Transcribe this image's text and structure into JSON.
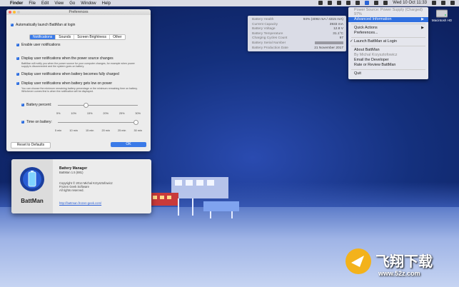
{
  "menubar": {
    "apple": "",
    "app": "Finder",
    "items": [
      "File",
      "Edit",
      "View",
      "Go",
      "Window",
      "Help"
    ],
    "clock": "Wed 10 Oct  11:33"
  },
  "prefs": {
    "title": "Preferences",
    "auto_launch": "Automatically launch BattMan at login",
    "tabs": [
      "Notifications",
      "Sounds",
      "Screen Brightness",
      "Other"
    ],
    "enable": "Enable user notifications",
    "opt1": "Display user notifications when the power source changes",
    "opt1_note": "BattMan will notify you when the power source for your computer changes, for example when power supply is disconnected and the system goes on battery.",
    "opt2": "Display user notifications when battery becomes fully charged",
    "opt3": "Display user notifications when battery gets low on power",
    "opt3_note": "You can choose the minimum remaining battery percentage or the minimum remaining time on battery. Whichever comes first is when the notification will be displayed.",
    "battery_percent_label": "Battery percent:",
    "battery_percent_value": 0.35,
    "percent_ticks": [
      "5%",
      "10%",
      "15%",
      "20%",
      "25%",
      "30%"
    ],
    "time_label": "Time on battery:",
    "time_value": 1.0,
    "time_ticks": [
      "5 min",
      "10 min",
      "15 min",
      "20 min",
      "25 min",
      "30 min"
    ],
    "reset": "Reset to Defaults",
    "ok": "OK"
  },
  "about": {
    "app_name": "BattMan",
    "title": "Battery Manager",
    "version": "BattMan 1.5 (881)",
    "copyright1": "Copyright © 2014 Michal Krzysztofowicz",
    "copyright2": "Frozen Geek Software",
    "copyright3": "All rights reserved.",
    "link": "http://battman.frozen-geek.com/"
  },
  "info": {
    "rows": [
      {
        "label": "Battery Health",
        "value": "94% (4092 mA / 4315 mA)"
      },
      {
        "label": "Current Capacity",
        "value": "3933 mA"
      },
      {
        "label": "Battery Voltage",
        "value": "12.8 V"
      },
      {
        "label": "Battery Temperature",
        "value": "31.1°C"
      },
      {
        "label": "Charging Cycles Count",
        "value": "97"
      },
      {
        "label": "Battery Serial Number",
        "value": ""
      },
      {
        "label": "Battery Production Date",
        "value": "21 November 2017"
      }
    ]
  },
  "menu": {
    "power_source": "Power Source: Power Supply (Charged)",
    "percent": "97%",
    "advanced": "Advanced Information",
    "quick_actions": "Quick Actions",
    "preferences": "Preferences...",
    "launch": "Launch BattMan at Login",
    "about": "About BattMan",
    "by": "By Michal Krzysztofowicz",
    "email": "Email the Developer",
    "rate": "Rate or Review BattMan",
    "quit": "Quit"
  },
  "desktop": {
    "disk_label": "Macintosh HD"
  },
  "watermark": {
    "brand": "飞翔下载",
    "url": "www.52z.com"
  },
  "colors": {
    "accent": "#2f6fe0",
    "desktop": "#14307d"
  }
}
